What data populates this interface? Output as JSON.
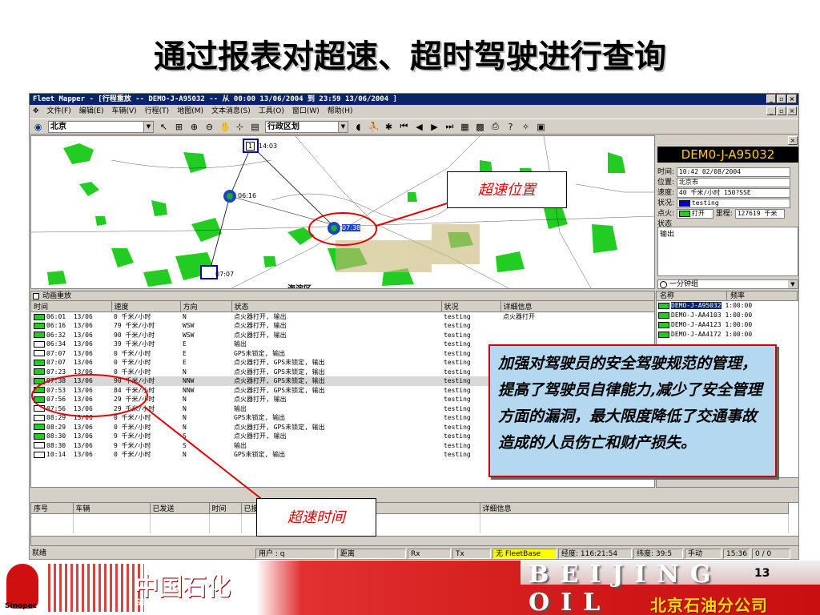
{
  "slide": {
    "title": "通过报表对超速、超时驾驶进行查询",
    "page_number": "13",
    "company_cn": "中国石化",
    "company_en": "SINOPEC CORP.",
    "logo_text": "Sinopec",
    "city_banner": "BEIJING OIL",
    "branch": "北京石油分公司"
  },
  "window": {
    "title": "Fleet Mapper - [行程重放 -- DEMO-J-A95032 -- 从 00:00 13/06/2004 到 23:59 13/06/2004 ]",
    "controls": [
      "_",
      "▫",
      "×"
    ]
  },
  "menu": [
    "文件(F)",
    "编辑(E)",
    "车辆(V)",
    "行程(T)",
    "地图(M)",
    "文本消息(S)",
    "工具(O)",
    "窗口(W)",
    "帮助(H)"
  ],
  "toolbar": {
    "city": "北京",
    "layer": "行政区划"
  },
  "map": {
    "markers": [
      {
        "label": "14:03",
        "flag": "1"
      },
      {
        "label": "06:16"
      },
      {
        "label": "07:38"
      },
      {
        "label": "07:07"
      }
    ],
    "district": "海淀区"
  },
  "vehicle_panel": {
    "id": "DEM0-J-A95032",
    "time_label": "时间:",
    "time_value": "10:42    02/08/2004",
    "position_label": "位置:",
    "position_value": "北京市",
    "speed_label": "速度:",
    "speed_value": "40 千米/小时   150?SSE",
    "status_label": "状况:",
    "status_value": "testing",
    "ignition_label": "点火:",
    "ignition_value": "打开",
    "mileage_label": "里程:",
    "mileage_value": "127619 千米",
    "state_label": "状态",
    "state_value": "输出",
    "freq_option": "一分钟组"
  },
  "replay": {
    "title": "动画重放",
    "columns": [
      "时间",
      "速度",
      "方向",
      "状态",
      "状况",
      "详细信息"
    ],
    "rows": [
      {
        "icon": "green",
        "time": "06:01",
        "date": "13/06",
        "speed": "0 千米/小时",
        "dir": "N",
        "status": "点火器打开,   输出",
        "cond": "testing",
        "detail": "点火器打开"
      },
      {
        "icon": "green",
        "time": "06:16",
        "date": "13/06",
        "speed": "79 千米/小时",
        "dir": "WSW",
        "status": "点火器打开,   输出",
        "cond": "testing",
        "detail": ""
      },
      {
        "icon": "green",
        "time": "06:32",
        "date": "13/06",
        "speed": "90 千米/小时",
        "dir": "WSW",
        "status": "点火器打开,   输出",
        "cond": "testing",
        "detail": ""
      },
      {
        "icon": "white",
        "time": "06:34",
        "date": "13/06",
        "speed": "39 千米/小时",
        "dir": "E",
        "status": "输出",
        "cond": "testing",
        "detail": ""
      },
      {
        "icon": "white",
        "time": "07:07",
        "date": "13/06",
        "speed": "0 千米/小时",
        "dir": "E",
        "status": "GPS未锁定,   输出",
        "cond": "testing",
        "detail": ""
      },
      {
        "icon": "green",
        "time": "07:07",
        "date": "13/06",
        "speed": "0 千米/小时",
        "dir": "E",
        "status": "点火器打开,   GPS未锁定,   输出",
        "cond": "testing",
        "detail": ""
      },
      {
        "icon": "green",
        "time": "07:23",
        "date": "13/06",
        "speed": "0 千米/小时",
        "dir": "N",
        "status": "点火器打开,   GPS未锁定,   输出",
        "cond": "testing",
        "detail": ""
      },
      {
        "icon": "green",
        "time": "07:38",
        "date": "13/06",
        "speed": "90 千米/小时",
        "dir": "NNW",
        "status": "点火器打开,   GPS未锁定,   输出",
        "cond": "testing",
        "detail": "",
        "selected": true
      },
      {
        "icon": "green",
        "time": "07:53",
        "date": "13/06",
        "speed": "84 千米/小时",
        "dir": "NNW",
        "status": "点火器打开,   GPS未锁定,   输出",
        "cond": "testing",
        "detail": ""
      },
      {
        "icon": "green",
        "time": "07:56",
        "date": "13/06",
        "speed": "29 千米/小时",
        "dir": "N",
        "status": "点火器打开,   输出",
        "cond": "testing",
        "detail": ""
      },
      {
        "icon": "white",
        "time": "07:56",
        "date": "13/06",
        "speed": "29 千米/小时",
        "dir": "N",
        "status": "输出",
        "cond": "testing",
        "detail": ""
      },
      {
        "icon": "white",
        "time": "08:29",
        "date": "13/06",
        "speed": "0 千米/小时",
        "dir": "N",
        "status": "GPS未锁定,   输出",
        "cond": "testing",
        "detail": ""
      },
      {
        "icon": "green",
        "time": "08:29",
        "date": "13/06",
        "speed": "0 千米/小时",
        "dir": "N",
        "status": "点火器打开,   GPS未锁定,   输出",
        "cond": "testing",
        "detail": ""
      },
      {
        "icon": "green",
        "time": "08:30",
        "date": "13/06",
        "speed": "9 千米/小时",
        "dir": "S",
        "status": "点火器打开,   输出",
        "cond": "testing",
        "detail": ""
      },
      {
        "icon": "white",
        "time": "08:30",
        "date": "13/06",
        "speed": "9 千米/小时",
        "dir": "S",
        "status": "输出",
        "cond": "testing",
        "detail": ""
      },
      {
        "icon": "white",
        "time": "10:14",
        "date": "13/06",
        "speed": "0 千米/小时",
        "dir": "N",
        "status": "GPS未锁定,   输出",
        "cond": "testing",
        "detail": ""
      }
    ]
  },
  "vehicles": {
    "columns": [
      "名称",
      "频率"
    ],
    "rows": [
      {
        "name": "DEMO-J-A95032",
        "freq": "1:00:00",
        "selected": true
      },
      {
        "name": "DEMO-J-AA4103",
        "freq": "1:00:00"
      },
      {
        "name": "DEMO-J-AA4123",
        "freq": "1:00:00"
      },
      {
        "name": "DEMO-J-AA4172",
        "freq": "1:00:00"
      }
    ]
  },
  "messages": {
    "columns": [
      "序号",
      "车辆",
      "已发送",
      "时间",
      "已接收",
      "时间",
      "消息状态",
      "详细信息"
    ]
  },
  "statusbar": {
    "ready": "就绪",
    "user": "用户 : q",
    "distance": "距离",
    "rx": "Rx",
    "tx": "Tx",
    "fleetbase": "无 FleetBase",
    "longitude": "经度: 116:21:54",
    "latitude": "纬度: 39:5",
    "mode": "手动",
    "clock": "15:36",
    "counter": "0 / 0"
  },
  "annotations": {
    "speeding_location": "超速位置",
    "speeding_time": "超速时间",
    "note": "加强对驾驶员的安全驾驶规范的管理，提高了驾驶员自律能力,减少了安全管理方面的漏洞，最大限度降低了交通事故造成的人员伤亡和财产损失。"
  },
  "colors": {
    "titlebar": "#0a246a",
    "map_green": "#22cc22",
    "annotation_red": "#e00000",
    "note_bg": "#b4d8f0",
    "vehicle_id_fg": "#ffcc33"
  }
}
